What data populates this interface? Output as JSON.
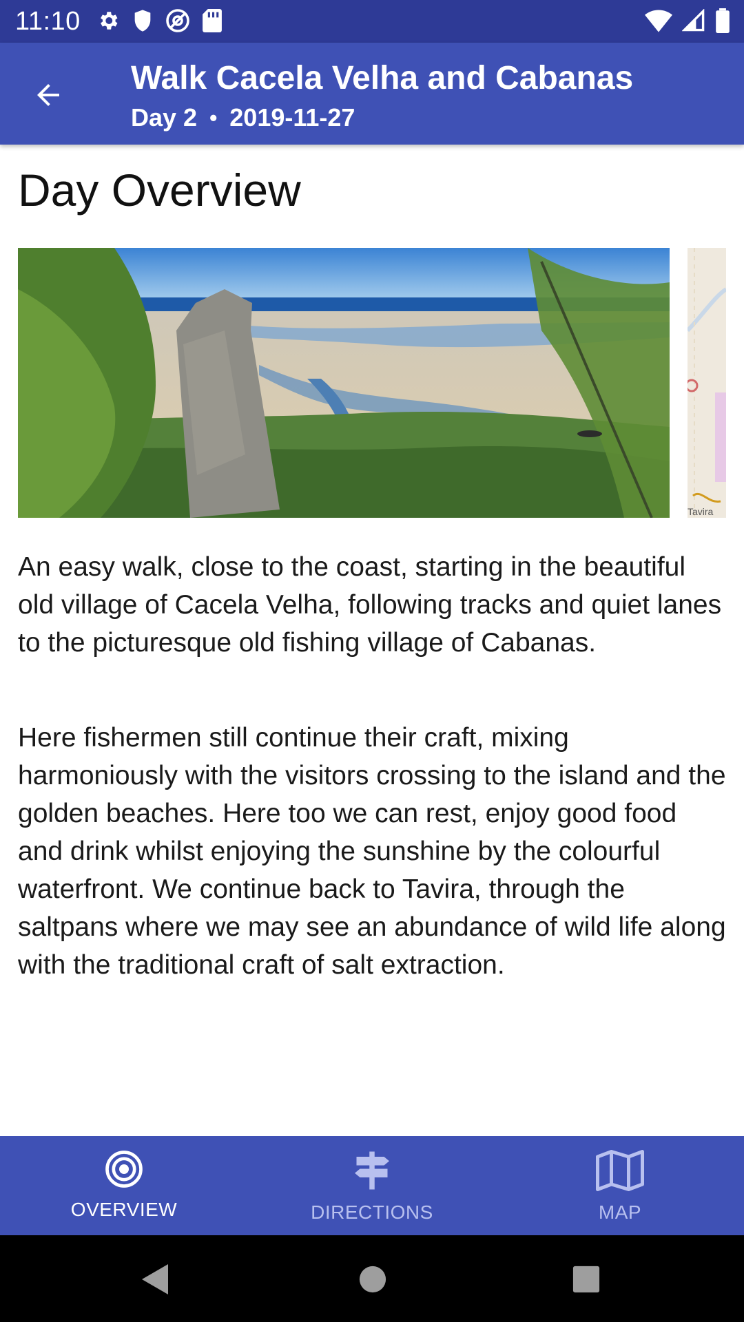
{
  "status_bar": {
    "time": "11:10",
    "icons_left": [
      "gear-icon",
      "shield-icon",
      "at-icon",
      "sd-card-icon"
    ],
    "icons_right": [
      "wifi-icon",
      "signal-icon",
      "battery-icon"
    ]
  },
  "app_bar": {
    "title": "Walk Cacela Velha and Cabanas",
    "day_label": "Day 2",
    "separator": "•",
    "date": "2019-11-27",
    "back_icon": "arrow-back-icon"
  },
  "content": {
    "heading": "Day Overview",
    "partial_map_label": "Tavira",
    "paragraphs": [
      "An easy walk, close to the coast, starting in the beautiful old village of Cacela Velha, following tracks and quiet lanes to the picturesque old fishing village of Cabanas.",
      "Here fishermen still continue their craft, mixing harmoniously with the visitors crossing to the island and the golden beaches. Here too we can rest, enjoy good food and drink whilst enjoying the sunshine by the colourful waterfront. We continue back to Tavira, through the saltpans where we may see an abundance of wild life along with the traditional craft of salt extraction."
    ]
  },
  "bottom_nav": {
    "items": [
      {
        "label": "OVERVIEW",
        "icon": "target-icon",
        "active": true
      },
      {
        "label": "DIRECTIONS",
        "icon": "signpost-icon",
        "active": false
      },
      {
        "label": "MAP",
        "icon": "map-icon",
        "active": false
      }
    ]
  },
  "colors": {
    "status_bar": "#2e3a96",
    "primary": "#3f51b5",
    "nav_inactive": "#b8c0ef"
  }
}
